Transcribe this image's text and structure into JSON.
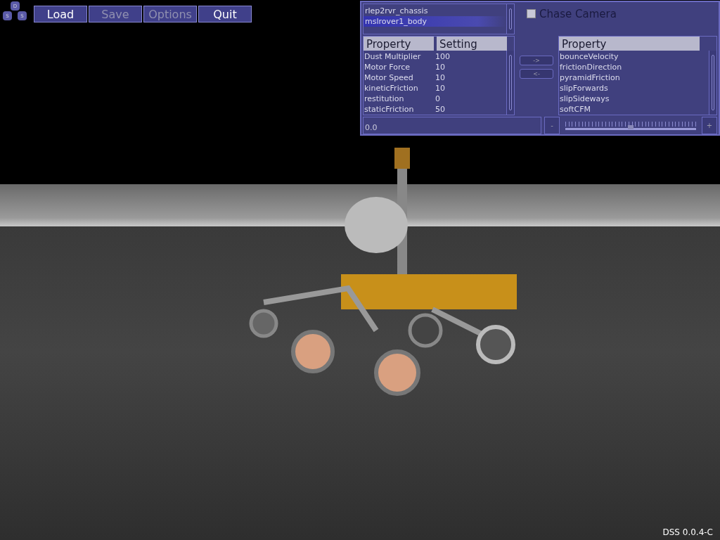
{
  "logo": {
    "letters": [
      "D",
      "S",
      "S"
    ]
  },
  "toolbar": [
    {
      "label": "Load",
      "disabled": false
    },
    {
      "label": "Save",
      "disabled": true
    },
    {
      "label": "Options",
      "disabled": true
    },
    {
      "label": "Quit",
      "disabled": false
    }
  ],
  "objects": [
    {
      "label": "rlep2rvr_chassis",
      "selected": false
    },
    {
      "label": "mslrover1_body",
      "selected": true
    }
  ],
  "chase_camera": {
    "label": "Chase Camera",
    "checked": false
  },
  "property_table": {
    "columns": [
      "Property",
      "Setting"
    ],
    "rows": [
      [
        "Dust Multiplier",
        "100"
      ],
      [
        "Motor Force",
        "10"
      ],
      [
        "Motor Speed",
        "10"
      ],
      [
        "kineticFriction",
        "10"
      ],
      [
        "restitution",
        "0"
      ],
      [
        "staticFriction",
        "50"
      ]
    ]
  },
  "move_buttons": [
    "->",
    "<-"
  ],
  "available_table": {
    "columns": [
      "Property"
    ],
    "rows": [
      "bounceVelocity",
      "frictionDirection",
      "pyramidFriction",
      "slipForwards",
      "slipSideways",
      "softCFM"
    ]
  },
  "value_field": {
    "value": "0.0"
  },
  "decrement": "-",
  "increment": "+",
  "slider": {
    "level": 0.5
  },
  "version": "DSS 0.0.4-C"
}
